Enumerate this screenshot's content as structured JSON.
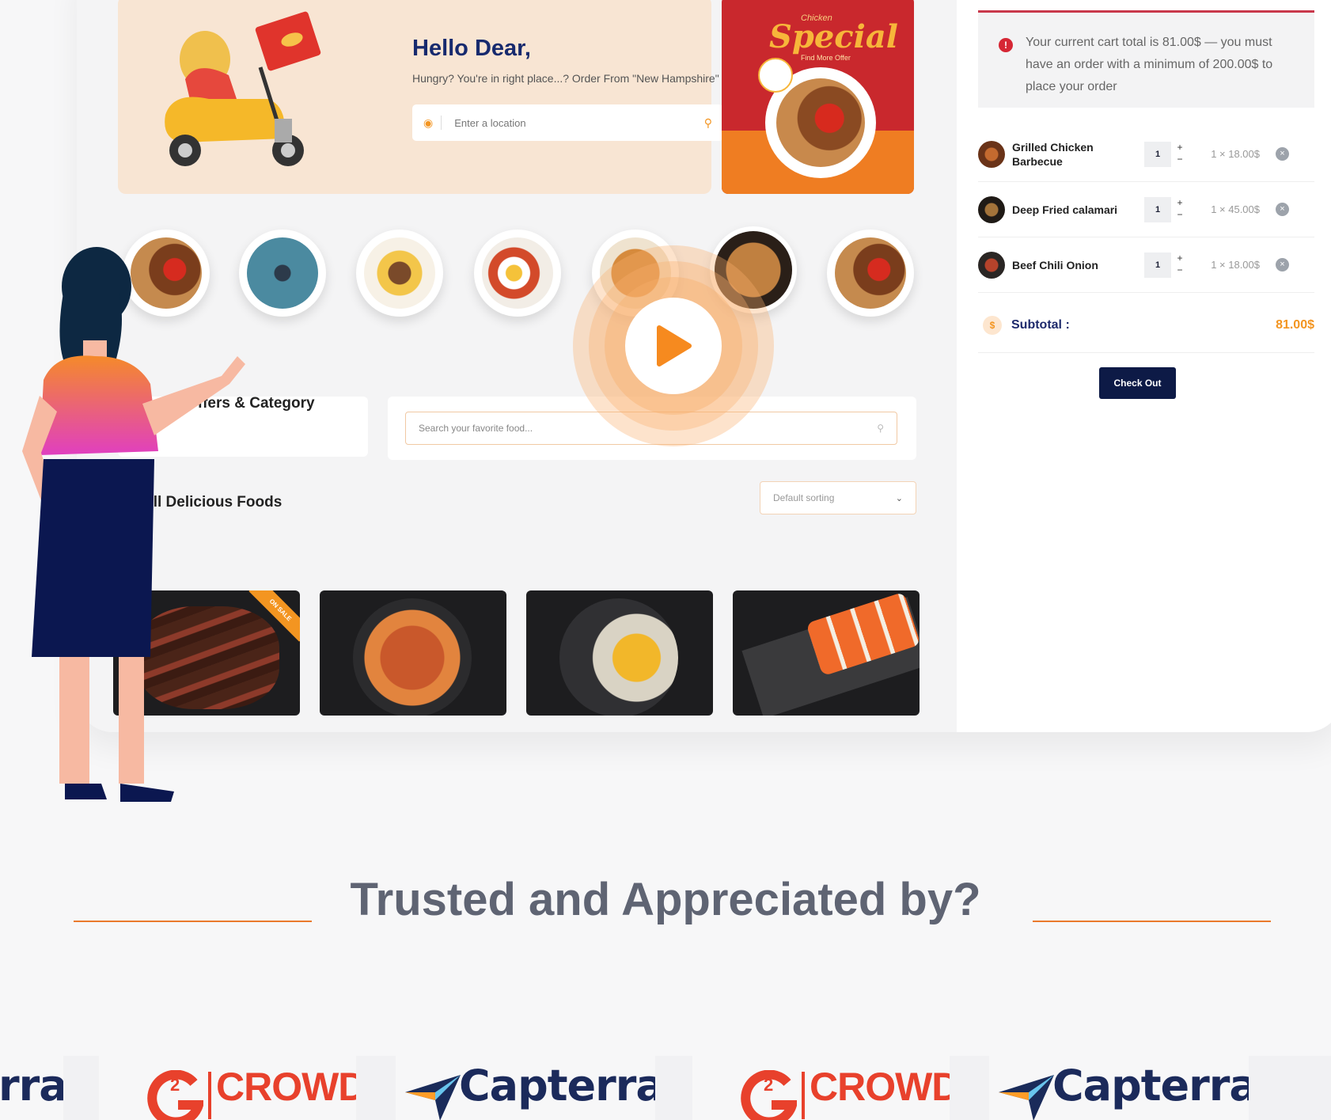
{
  "hero": {
    "title": "Hello Dear,",
    "subtitle": "Hungry? You're in right place...? Order From \"New Hampshire\"",
    "location_placeholder": "Enter a location"
  },
  "promo": {
    "small_text": "Chicken",
    "title": "Special",
    "subtitle": "Find More Offer"
  },
  "categories": {
    "label": "Offers & Category",
    "search_placeholder": "Search your favorite food..."
  },
  "foods": {
    "title": "All Delicious Foods",
    "sort_value": "Default sorting",
    "sale_badge": "ON SALE"
  },
  "cart": {
    "notice": "Your current cart total is 81.00$ — you must have an order with a minimum of 200.00$ to place your order",
    "items": [
      {
        "name": "Grilled Chicken Barbecue",
        "qty": "1",
        "price": "1 × 18.00$"
      },
      {
        "name": "Deep Fried calamari",
        "qty": "1",
        "price": "1 × 45.00$"
      },
      {
        "name": "Beef Chili Onion",
        "qty": "1",
        "price": "1 × 18.00$"
      }
    ],
    "subtotal_label": "Subtotal :",
    "subtotal_value": "81.00$",
    "checkout_label": "Check Out"
  },
  "trusted": {
    "title": "Trusted and Appreciated by?"
  },
  "logos": {
    "g2_text": "CROWD",
    "capterra_text": "Capterra",
    "capterra_partial": "rra"
  },
  "colors": {
    "accent": "#f39521",
    "navy": "#0d1a46",
    "alert_red": "#d62734",
    "heading_gray": "#5f6473"
  }
}
